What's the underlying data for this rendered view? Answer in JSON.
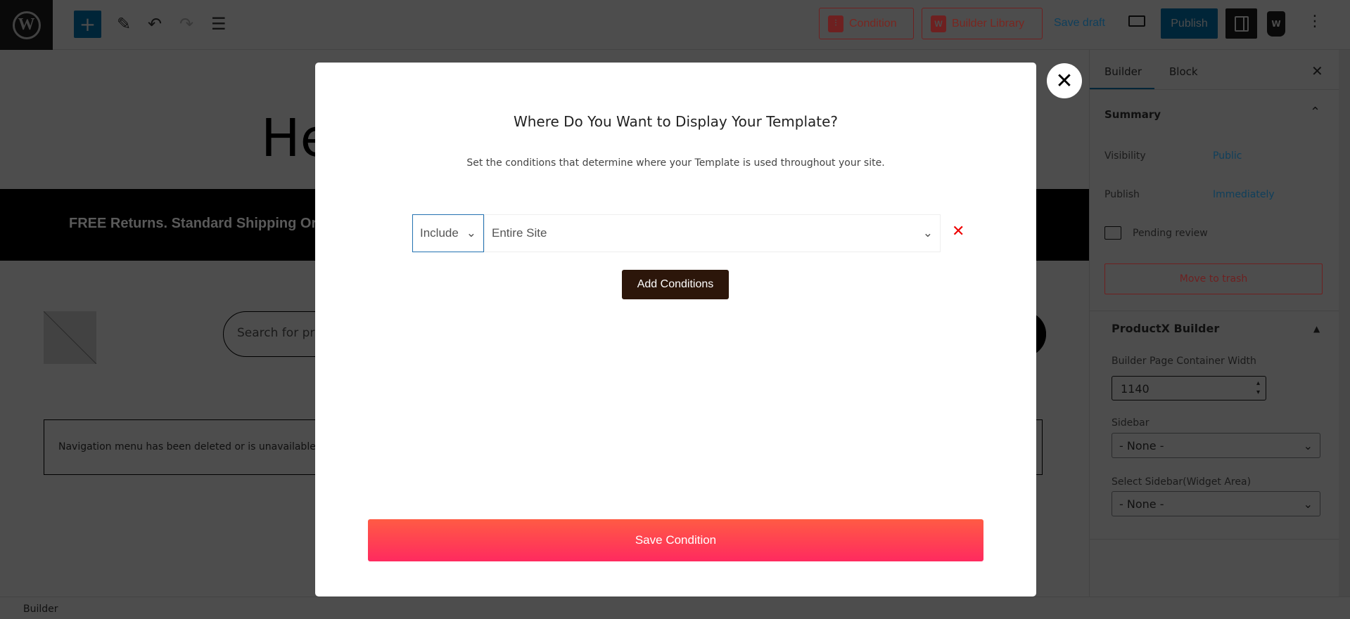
{
  "toolbar": {
    "logo": "W",
    "add_icon": "plus-icon",
    "condition_label": "Condition",
    "builder_library_label": "Builder Library",
    "save_draft": "Save draft",
    "publish": "Publish"
  },
  "canvas": {
    "heading": "He",
    "banner_text": "FREE Returns. Standard Shipping Order",
    "search_placeholder": "Search for pro",
    "nav_notice": "Navigation menu has been deleted or is unavailable"
  },
  "sidebar": {
    "tabs": [
      "Builder",
      "Block"
    ],
    "summary_title": "Summary",
    "visibility_label": "Visibility",
    "visibility_value": "Public",
    "publish_label": "Publish",
    "publish_value": "Immediately",
    "pending_review": "Pending review",
    "move_to_trash": "Move to trash",
    "productx_title": "ProductX Builder",
    "container_width_label": "Builder Page Container Width",
    "container_width_value": "1140",
    "sidebar_label": "Sidebar",
    "sidebar_value": "- None -",
    "widget_label": "Select Sidebar(Widget Area)",
    "widget_value": "- None -"
  },
  "status_bar": {
    "breadcrumb": "Builder"
  },
  "modal": {
    "title": "Where Do You Want to Display Your Template?",
    "subtitle": "Set the conditions that determine where your Template is used throughout your site.",
    "include_value": "Include",
    "scope_value": "Entire Site",
    "add_conditions": "Add Conditions",
    "save_condition": "Save Condition"
  },
  "colors": {
    "accent": "#007cba",
    "danger": "#d63638",
    "add_button": "#2c160a",
    "save_gradient_start": "#ff5b44",
    "save_gradient_end": "#ff2a5f"
  }
}
